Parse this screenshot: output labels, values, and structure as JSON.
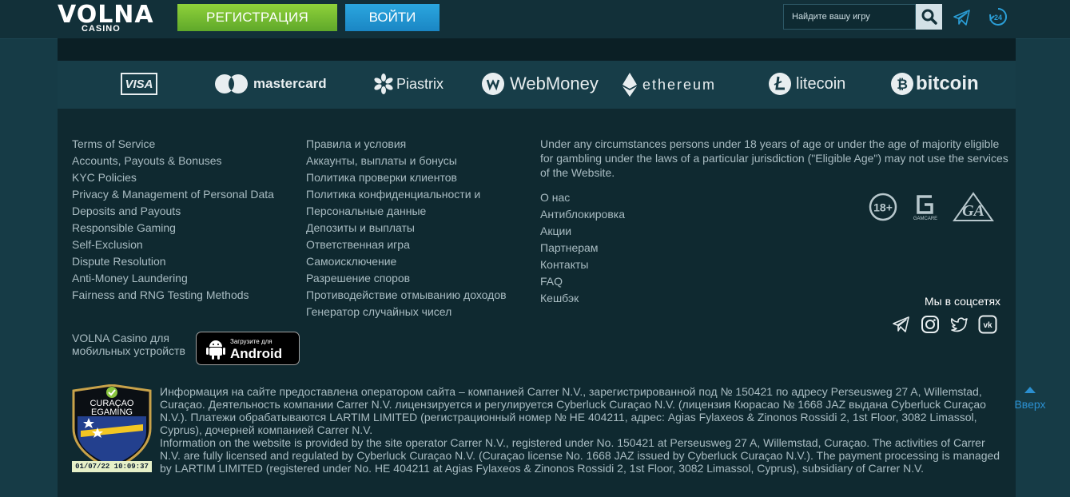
{
  "header": {
    "logo_main": "VOLNA",
    "logo_sub": "CASINO",
    "register_label": "РЕГИСТРАЦИЯ",
    "login_label": "ВОЙТИ",
    "search_placeholder": "Найдите вашу игру",
    "support_badge": "24"
  },
  "payments": [
    "VISA",
    "mastercard",
    "Piastrix",
    "WebMoney",
    "ethereum",
    "litecoin",
    "bitcoin"
  ],
  "links_en": [
    "Terms of Service",
    "Accounts, Payouts & Bonuses",
    "KYC Policies",
    "Privacy & Management of Personal Data",
    "Deposits and Payouts",
    "Responsible Gaming",
    "Self-Exclusion",
    "Dispute Resolution",
    "Anti-Money Laundering",
    "Fairness and RNG Testing Methods"
  ],
  "links_ru": [
    "Правила и условия",
    "Аккаунты, выплаты и бонусы",
    "Политика проверки клиентов",
    "Политика конфиденциальности и",
    "Персональные данные",
    "Депозиты и выплаты",
    "Ответственная игра",
    "Самоисключение",
    "Разрешение споров",
    "Противодействие отмыванию доходов",
    "Генератор случайных чисел"
  ],
  "age_notice": "Under any circumstances persons under 18 years of age or under the age of majority eligible for gambling under the laws of a particular jurisdiction (\"Eligible Age\") may not use the services of the Website.",
  "links_info": [
    "О нас",
    "Антиблокировка",
    "Акции",
    "Партнерам",
    "Контакты",
    "FAQ",
    "Кешбэк"
  ],
  "badges": {
    "age": "18+",
    "gamcare": "GAMCARE",
    "ga": "GA"
  },
  "social": {
    "label": "Мы в соцсетях"
  },
  "app": {
    "line1": "VOLNA Casino для",
    "line2": "мобильных устройств",
    "store_small": "Загрузите для",
    "store_big": "Android"
  },
  "seal": {
    "line1": "CURAÇAO",
    "line2": "EGAMING",
    "date": "01/07/22 10:09:37"
  },
  "legal_ru": "Информация на сайте предоставлена оператором сайта – компанией Carrer N.V., зарегистрированной под № 150421 по адресу Perseusweg 27 A, Willemstad, Curaçao. Деятельность компании Carrer N.V. лицензируется и регулируется Cyberluck Curaçao N.V. (лицензия Кюрасао № 1668 JAZ выдана Cyberluck Curaçao N.V.). Платежи обрабатываются LARTIM LIMITED (регистрационный номер № HE 404211, адрес: Agias Fylaxeos & Zinonos Rossidi 2, 1st Floor, 3082 Limassol, Cyprus), дочерней компанией Carrer N.V.",
  "legal_en": "Information on the website is provided by the site operator Carrer N.V., registered under No. 150421 at Perseusweg 27 A, Willemstad, Curaçao. The activities of Carrer N.V. are fully licensed and regulated by Cyberluck Curaçao N.V. (Curaçao license No. 1668 JAZ issued by Cyberluck Curaçao N.V.). The payment processing is managed by LARTIM LIMITED (registered under No. HE 404211 at Agias Fylaxeos & Zinonos Rossidi 2, 1st Floor, 3082 Limassol, Cyprus), subsidiary of Carrer N.V.",
  "scroll_up_label": "Вверх"
}
